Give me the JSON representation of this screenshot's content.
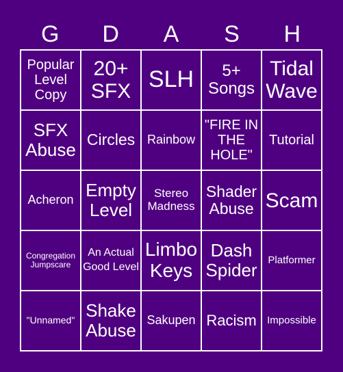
{
  "header": [
    "G",
    "D",
    "A",
    "S",
    "H"
  ],
  "colors": {
    "background": "#4f0080",
    "lines": "#ffffff",
    "text": "#ffffff"
  },
  "cells": [
    "Popular Level Copy",
    "20+ SFX",
    "SLH",
    "5+ Songs",
    "Tidal Wave",
    "SFX Abuse",
    "Circles",
    "Rainbow",
    "\"FIRE IN THE HOLE\"",
    "Tutorial",
    "Acheron",
    "Empty Level",
    "Stereo Madness",
    "Shader Abuse",
    "Scam",
    "Congregation Jumpscare",
    "An Actual Good Level",
    "Limbo Keys",
    "Dash Spider",
    "Platformer",
    "\"Unnamed\"",
    "Shake Abuse",
    "Sakupen",
    "Racism",
    "Impossible"
  ]
}
